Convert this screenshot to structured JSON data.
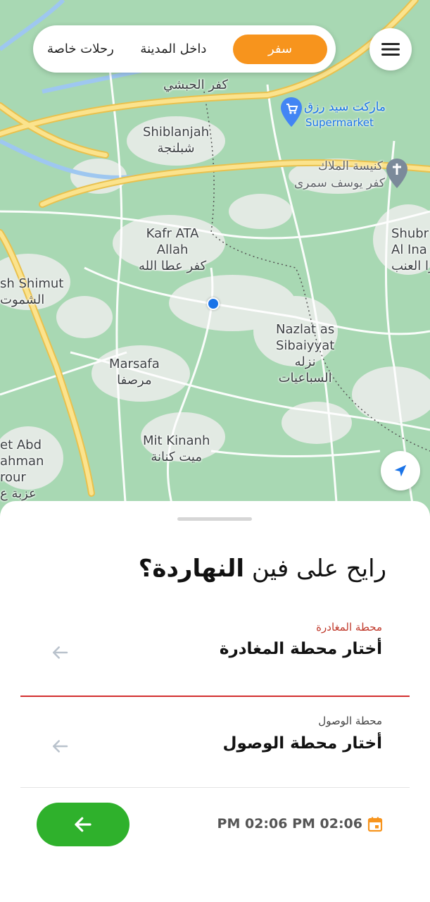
{
  "tabs": {
    "travel": "سفر",
    "in_city": "داخل المدينة",
    "private": "رحلات خاصة"
  },
  "colors": {
    "accent": "#f7941d",
    "error": "#d32f2f",
    "go_button": "#2fb12c",
    "map_green": "#a8d8b3",
    "road_yellow": "#f9d96a",
    "location_dot": "#1a73e8"
  },
  "map": {
    "labels": {
      "kafr_habashi": "كفر الحبشي",
      "shiblanjah_en": "Shiblanjah",
      "shiblanjah_ar": "شبلنجة",
      "kafr_ata_en1": "Kafr ATA",
      "kafr_ata_en2": "Allah",
      "kafr_ata_ar": "كفر عطا الله",
      "shimut_en": "sh Shimut",
      "shimut_ar": "الشموت",
      "nazlat_en1": "Nazlat as",
      "nazlat_en2": "Sibaiyyat",
      "nazlat_ar1": "نزله",
      "nazlat_ar2": "السباعيات",
      "marsafa_en": "Marsafa",
      "marsafa_ar": "مرصفا",
      "mit_kinanh_en": "Mit Kinanh",
      "mit_kinanh_ar": "ميت كنانة",
      "shubra_en1": "Shubr",
      "shubra_en2": "Al Ina",
      "shubra_ar": "را العنب",
      "abd_en1": "et Abd",
      "abd_en2": "ahman",
      "abd_en3": "rour",
      "abd_ar": "عزبة ع"
    },
    "pois": {
      "market_name": "ماركت سيد رزق",
      "market_type": "Supermarket",
      "church_name": "كنيسة الملاك",
      "church_sub": "كفر يوسف سمرى"
    },
    "icons": {
      "menu": "menu-icon",
      "locate": "navigation-arrow-icon",
      "market_pin": "shopping-cart-pin-icon",
      "church_pin": "cross-pin-icon"
    }
  },
  "sheet": {
    "question_prefix": "رايح على فين",
    "question_bold": "النهاردة؟",
    "departure_label": "محطة المغادرة",
    "departure_placeholder": "أختار محطة المغادرة",
    "arrival_label": "محطة الوصول",
    "arrival_placeholder": "أختار محطة الوصول",
    "time_range": "PM 02:06  PM 02:06",
    "icons": {
      "calendar": "calendar-icon",
      "go": "arrow-left-icon",
      "field_arrow": "arrow-left-icon"
    }
  }
}
